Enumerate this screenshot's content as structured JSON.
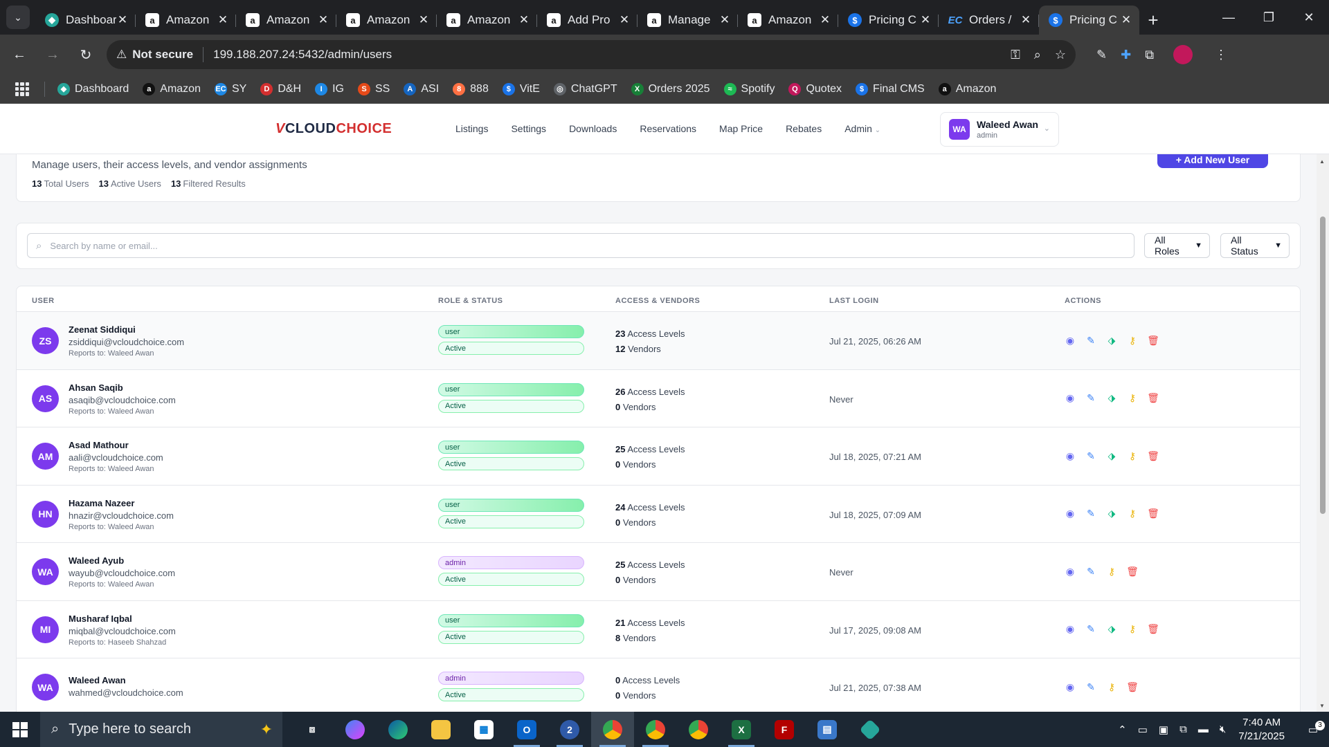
{
  "browser": {
    "tabs": [
      {
        "title": "Dashboard",
        "icon": "dashboard-favicon",
        "active": false
      },
      {
        "title": "Amazon",
        "icon": "amazon-favicon",
        "active": false
      },
      {
        "title": "Amazon",
        "icon": "amazon-favicon",
        "active": false
      },
      {
        "title": "Amazon",
        "icon": "amazon-favicon",
        "active": false
      },
      {
        "title": "Amazon",
        "icon": "amazon-favicon",
        "active": false
      },
      {
        "title": "Add Pro",
        "icon": "amazon-favicon",
        "active": false
      },
      {
        "title": "Manage",
        "icon": "amazon-favicon",
        "active": false
      },
      {
        "title": "Amazon",
        "icon": "amazon-favicon",
        "active": false
      },
      {
        "title": "Pricing C",
        "icon": "dollar-favicon",
        "active": false
      },
      {
        "title": "Orders /",
        "icon": "ec-favicon",
        "active": false
      },
      {
        "title": "Pricing C",
        "icon": "dollar-favicon",
        "active": true
      }
    ],
    "not_secure_label": "Not secure",
    "url": "199.188.207.24:5432/admin/users",
    "bookmarks": [
      {
        "label": "Dashboard",
        "color": "#26a69a",
        "glyph": "◆"
      },
      {
        "label": "Amazon",
        "color": "#111111",
        "glyph": "a"
      },
      {
        "label": "SY",
        "color": "#1e88e5",
        "glyph": "EC"
      },
      {
        "label": "D&H",
        "color": "#d32f2f",
        "glyph": "D"
      },
      {
        "label": "IG",
        "color": "#1e88e5",
        "glyph": "I"
      },
      {
        "label": "SS",
        "color": "#e64a19",
        "glyph": "S"
      },
      {
        "label": "ASI",
        "color": "#1565c0",
        "glyph": "A"
      },
      {
        "label": "888",
        "color": "#ff7043",
        "glyph": "8"
      },
      {
        "label": "VitE",
        "color": "#1a73e8",
        "glyph": "$"
      },
      {
        "label": "ChatGPT",
        "color": "#5f6368",
        "glyph": "◎"
      },
      {
        "label": "Orders 2025",
        "color": "#188038",
        "glyph": "X"
      },
      {
        "label": "Spotify",
        "color": "#1db954",
        "glyph": "≈"
      },
      {
        "label": "Quotex",
        "color": "#c2185b",
        "glyph": "Q"
      },
      {
        "label": "Final CMS",
        "color": "#1a73e8",
        "glyph": "$"
      },
      {
        "label": "Amazon",
        "color": "#111111",
        "glyph": "a"
      }
    ]
  },
  "app": {
    "logo": {
      "v": "V",
      "cloud": "CLOUD",
      "choice": "CHOICE"
    },
    "nav": [
      "Listings",
      "Settings",
      "Downloads",
      "Reservations",
      "Map Price",
      "Rebates",
      "Admin"
    ],
    "current_user": {
      "initials": "WA",
      "name": "Waleed Awan",
      "role": "admin"
    }
  },
  "summary": {
    "description": "Manage users, their access levels, and vendor assignments",
    "total_users": "13",
    "total_users_label": "Total Users",
    "active_users": "13",
    "active_users_label": "Active Users",
    "filtered_results": "13",
    "filtered_results_label": "Filtered Results",
    "add_user_label": "+ Add New User"
  },
  "filters": {
    "search_placeholder": "Search by name or email...",
    "search_value": "",
    "roles_selected": "All Roles",
    "status_selected": "All Status"
  },
  "table": {
    "headers": {
      "user": "USER",
      "role_status": "ROLE & STATUS",
      "access_vendors": "ACCESS & VENDORS",
      "last_login": "LAST LOGIN",
      "actions": "ACTIONS"
    },
    "access_label": "Access Levels",
    "vendors_label": "Vendors",
    "rows": [
      {
        "initials": "ZS",
        "name": "Zeenat Siddiqui",
        "email": "zsiddiqui@vcloudchoice.com",
        "reports_to": "Reports to: Waleed Awan",
        "role": "user",
        "status": "Active",
        "access_levels": "23",
        "vendors": "12",
        "last_login": "Jul 21, 2025, 06:26 AM",
        "actions": [
          "view",
          "edit",
          "tag",
          "key",
          "delete"
        ]
      },
      {
        "initials": "AS",
        "name": "Ahsan Saqib",
        "email": "asaqib@vcloudchoice.com",
        "reports_to": "Reports to: Waleed Awan",
        "role": "user",
        "status": "Active",
        "access_levels": "26",
        "vendors": "0",
        "last_login": "Never",
        "actions": [
          "view",
          "edit",
          "tag",
          "key",
          "delete"
        ]
      },
      {
        "initials": "AM",
        "name": "Asad Mathour",
        "email": "aali@vcloudchoice.com",
        "reports_to": "Reports to: Waleed Awan",
        "role": "user",
        "status": "Active",
        "access_levels": "25",
        "vendors": "0",
        "last_login": "Jul 18, 2025, 07:21 AM",
        "actions": [
          "view",
          "edit",
          "tag",
          "key",
          "delete"
        ]
      },
      {
        "initials": "HN",
        "name": "Hazama Nazeer",
        "email": "hnazir@vcloudchoice.com",
        "reports_to": "Reports to: Waleed Awan",
        "role": "user",
        "status": "Active",
        "access_levels": "24",
        "vendors": "0",
        "last_login": "Jul 18, 2025, 07:09 AM",
        "actions": [
          "view",
          "edit",
          "tag",
          "key",
          "delete"
        ]
      },
      {
        "initials": "WA",
        "name": "Waleed Ayub",
        "email": "wayub@vcloudchoice.com",
        "reports_to": "Reports to: Waleed Awan",
        "role": "admin",
        "status": "Active",
        "access_levels": "25",
        "vendors": "0",
        "last_login": "Never",
        "actions": [
          "view",
          "edit",
          "key",
          "delete"
        ]
      },
      {
        "initials": "MI",
        "name": "Musharaf Iqbal",
        "email": "miqbal@vcloudchoice.com",
        "reports_to": "Reports to: Haseeb Shahzad",
        "role": "user",
        "status": "Active",
        "access_levels": "21",
        "vendors": "8",
        "last_login": "Jul 17, 2025, 09:08 AM",
        "actions": [
          "view",
          "edit",
          "tag",
          "key",
          "delete"
        ]
      },
      {
        "initials": "WA",
        "name": "Waleed Awan",
        "email": "wahmed@vcloudchoice.com",
        "reports_to": "",
        "role": "admin",
        "status": "Active",
        "access_levels": "0",
        "vendors": "0",
        "last_login": "Jul 21, 2025, 07:38 AM",
        "actions": [
          "view",
          "edit",
          "key",
          "delete"
        ]
      }
    ]
  },
  "taskbar": {
    "search_placeholder": "Type here to search",
    "time": "7:40 AM",
    "date": "7/21/2025",
    "notifications": "3"
  },
  "colors": {
    "accent": "#4f46e5",
    "avatar": "#7c3aed",
    "danger": "#ef4444",
    "success": "#10b981"
  }
}
